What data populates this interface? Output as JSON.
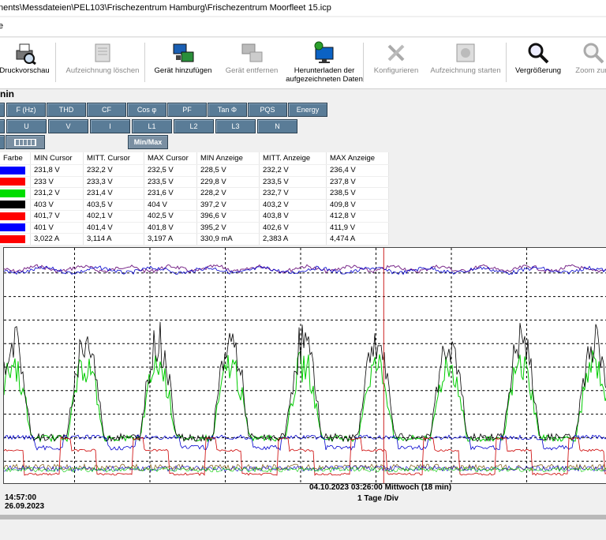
{
  "window": {
    "title": "nents\\Messdateien\\PEL103\\Frischezentrum Hamburg\\Frischezentrum Moorfleet 15.icp",
    "menu_partial": "e"
  },
  "toolbar": [
    {
      "label": "Druckvorschau",
      "lines": [
        "Druckvorschau"
      ],
      "enabled": true,
      "icon": "print-preview-icon"
    },
    {
      "label": "Aufzeichnung löschen",
      "lines": [
        "Aufzeichnung löschen"
      ],
      "enabled": false,
      "icon": "delete-recording-icon"
    },
    {
      "label": "Gerät hinzufügen",
      "lines": [
        "Gerät hinzufügen"
      ],
      "enabled": true,
      "icon": "add-device-icon"
    },
    {
      "label": "Gerät entfernen",
      "lines": [
        "Gerät entfernen"
      ],
      "enabled": false,
      "icon": "remove-device-icon"
    },
    {
      "label": "Herunterladen der aufgezeichneten Daten",
      "lines": [
        "Herunterladen der",
        "aufgezeichneten Daten"
      ],
      "enabled": true,
      "icon": "download-data-icon"
    },
    {
      "label": "Konfigurieren",
      "lines": [
        "Konfigurieren"
      ],
      "enabled": false,
      "icon": "configure-tools-icon"
    },
    {
      "label": "Aufzeichnung starten",
      "lines": [
        "Aufzeichnung starten"
      ],
      "enabled": false,
      "icon": "start-recording-icon"
    },
    {
      "label": "Vergrößerung",
      "lines": [
        "Vergrößerung"
      ],
      "enabled": true,
      "icon": "magnifier-icon"
    },
    {
      "label": "Zoom zurü",
      "lines": [
        "Zoom zurü"
      ],
      "enabled": false,
      "icon": "zoom-reset-icon"
    }
  ],
  "section_title": "nin",
  "param_buttons": [
    "F (Hz)",
    "THD",
    "CF",
    "Cos φ",
    "PF",
    "Tan Φ",
    "PQS",
    "Energy"
  ],
  "channel_buttons": [
    "U",
    "V",
    "I",
    "L1",
    "L2",
    "L3",
    "N"
  ],
  "minmax_label": "Min/Max",
  "table": {
    "headers": [
      "Farbe",
      "MIN Cursor",
      "MITT. Cursor",
      "MAX Cursor",
      "MIN Anzeige",
      "MITT. Anzeige",
      "MAX Anzeige"
    ],
    "rows": [
      {
        "color": "#0000ff",
        "cells": [
          "231,8 V",
          "232,2 V",
          "232,5 V",
          "228,5 V",
          "232,2 V",
          "236,4 V"
        ]
      },
      {
        "color": "#ff0000",
        "cells": [
          "233 V",
          "233,3 V",
          "233,5 V",
          "229,8 V",
          "233,5 V",
          "237,8 V"
        ]
      },
      {
        "color": "#00dd00",
        "cells": [
          "231,2 V",
          "231,4 V",
          "231,6 V",
          "228,2 V",
          "232,7 V",
          "238,5 V"
        ]
      },
      {
        "color": "#000000",
        "cells": [
          "403 V",
          "403,5 V",
          "404 V",
          "397,2 V",
          "403,2 V",
          "409,8 V"
        ]
      },
      {
        "color": "#ff0000",
        "cells": [
          "401,7 V",
          "402,1 V",
          "402,5 V",
          "396,6 V",
          "403,8 V",
          "412,8 V"
        ]
      },
      {
        "color": "#0000ff",
        "cells": [
          "401 V",
          "401,4 V",
          "401,8 V",
          "395,2 V",
          "402,6 V",
          "411,9 V"
        ]
      },
      {
        "color": "#ff0000",
        "cells": [
          "3,022 A",
          "3,114 A",
          "3,197 A",
          "330,9 mA",
          "2,383 A",
          "4,474 A"
        ]
      }
    ]
  },
  "cursor": {
    "label": "04.10.2023 03:26:00 Mittwoch (18 min)",
    "position_fraction": 0.63
  },
  "time_div": "1 Tage /Div",
  "start": {
    "time": "14:57:00",
    "date": "26.09.2023"
  },
  "series_colors": {
    "black": "#000000",
    "green": "#00cc00",
    "blue": "#0000cc",
    "red": "#cc0000",
    "purple": "#7a2a8a",
    "brown": "#8a6a2a"
  }
}
